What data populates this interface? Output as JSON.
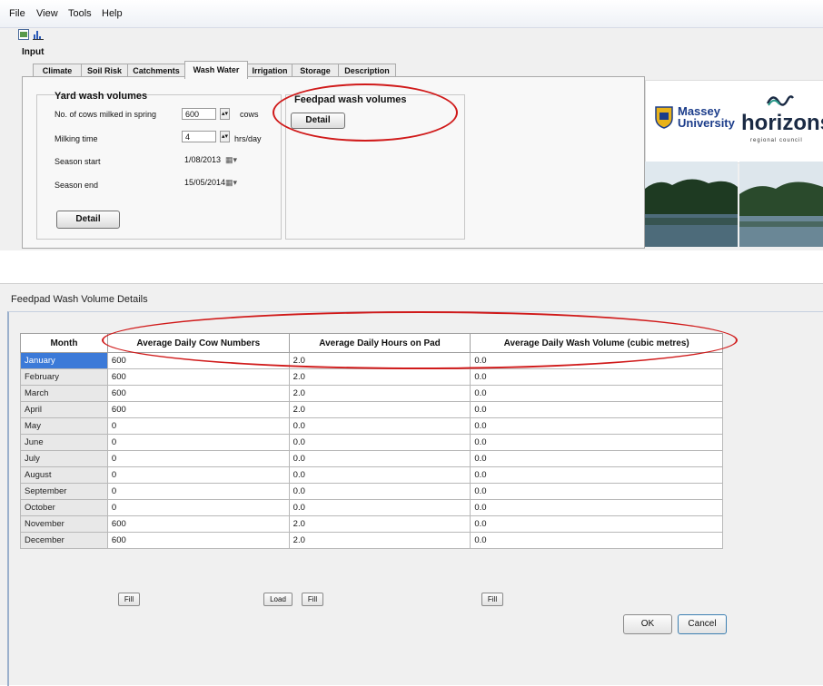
{
  "menu": [
    "File",
    "View",
    "Tools",
    "Help"
  ],
  "input_label": "Input",
  "tabs": [
    "Climate",
    "Soil Risk",
    "Catchments",
    "Wash Water",
    "Irrigation",
    "Storage",
    "Description"
  ],
  "active_tab": "Wash Water",
  "yard": {
    "title": "Yard wash volumes",
    "cows_label": "No. of cows milked in spring",
    "cows_value": "600",
    "cows_unit": "cows",
    "milking_label": "Milking time",
    "milking_value": "4",
    "milking_unit": "hrs/day",
    "season_start_label": "Season start",
    "season_start_value": "1/08/2013",
    "season_end_label": "Season end",
    "season_end_value": "15/05/2014",
    "detail_button": "Detail"
  },
  "feedpad": {
    "title": "Feedpad wash volumes",
    "detail_button": "Detail"
  },
  "logos": {
    "massey_line1": "Massey",
    "massey_line2": "University",
    "horizons": "horizons",
    "horizons_sub": "regional council"
  },
  "dialog": {
    "title": "Feedpad Wash Volume Details",
    "columns": [
      "Month",
      "Average Daily Cow Numbers",
      "Average Daily Hours on Pad",
      "Average Daily Wash Volume (cubic metres)"
    ],
    "rows": [
      [
        "January",
        "600",
        "2.0",
        "0.0"
      ],
      [
        "February",
        "600",
        "2.0",
        "0.0"
      ],
      [
        "March",
        "600",
        "2.0",
        "0.0"
      ],
      [
        "April",
        "600",
        "2.0",
        "0.0"
      ],
      [
        "May",
        "0",
        "0.0",
        "0.0"
      ],
      [
        "June",
        "0",
        "0.0",
        "0.0"
      ],
      [
        "July",
        "0",
        "0.0",
        "0.0"
      ],
      [
        "August",
        "0",
        "0.0",
        "0.0"
      ],
      [
        "September",
        "0",
        "0.0",
        "0.0"
      ],
      [
        "October",
        "0",
        "0.0",
        "0.0"
      ],
      [
        "November",
        "600",
        "2.0",
        "0.0"
      ],
      [
        "December",
        "600",
        "2.0",
        "0.0"
      ]
    ],
    "fill_label": "Fill",
    "load_label": "Load",
    "ok_label": "OK",
    "cancel_label": "Cancel"
  },
  "colors": {
    "annotation": "#d01a1a",
    "selection": "#3c7ad8"
  }
}
